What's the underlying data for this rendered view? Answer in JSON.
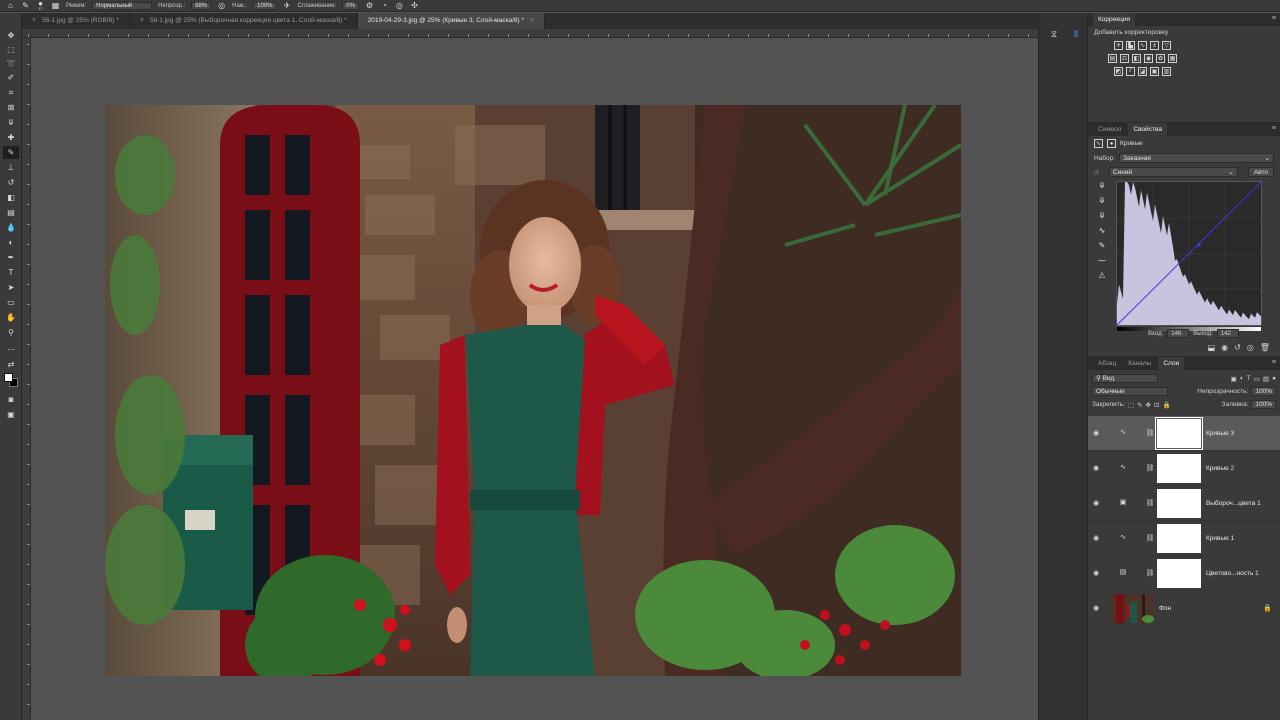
{
  "options_bar": {
    "brush_size": "17",
    "mode_label": "Режим:",
    "mode_value": "Нормальный",
    "opacity_label": "Непрозр.:",
    "opacity_value": "88%",
    "flow_label": "Наж.:",
    "flow_value": "100%",
    "smoothing_label": "Сглаживание:",
    "smoothing_value": "0%"
  },
  "tabs": [
    {
      "label": "56-1.jpg @ 25% (RGB/8) *",
      "active": false
    },
    {
      "label": "58-1.jpg @ 25% (Выборочная коррекция цвета 1, Слой-маска/8) *",
      "active": false
    },
    {
      "label": "2019-04-29-3.jpg @ 25% (Кривые 3, Слой-маска/8) *",
      "active": true
    }
  ],
  "adjustments": {
    "title": "Коррекция",
    "subtitle": "Добавить корректировку"
  },
  "properties": {
    "tabs": [
      "Символ",
      "Свойства"
    ],
    "active_tab": "Свойства",
    "type_label": "Кривые",
    "preset_label": "Набор:",
    "preset_value": "Заказная",
    "channel_value": "Синий",
    "auto_label": "Авто",
    "input_label": "Вход:",
    "input_value": "146",
    "output_label": "Выход:",
    "output_value": "142"
  },
  "layers_panel": {
    "tabs": [
      "Абзац",
      "Каналы",
      "Слои"
    ],
    "active_tab": "Слои",
    "filter_value": "Вид",
    "blend_mode": "Обычные",
    "opacity_label": "Непрозрачность:",
    "opacity_value": "100%",
    "lock_label": "Закрепить:",
    "fill_label": "Заливка:",
    "fill_value": "100%",
    "layers": [
      {
        "name": "Кривые 3",
        "type": "curves",
        "selected": true
      },
      {
        "name": "Кривые 2",
        "type": "curves",
        "selected": false
      },
      {
        "name": "Выбороч...цвета 1",
        "type": "selective-color",
        "selected": false
      },
      {
        "name": "Кривые 1",
        "type": "curves",
        "selected": false
      },
      {
        "name": "Цветово...ность 1",
        "type": "hue-saturation",
        "selected": false
      },
      {
        "name": "Фон",
        "type": "background",
        "selected": false
      }
    ]
  },
  "colors": {
    "accent": "#1f78d1",
    "curve_line": "#3b3bd8",
    "histogram": "#d9d4f2"
  }
}
